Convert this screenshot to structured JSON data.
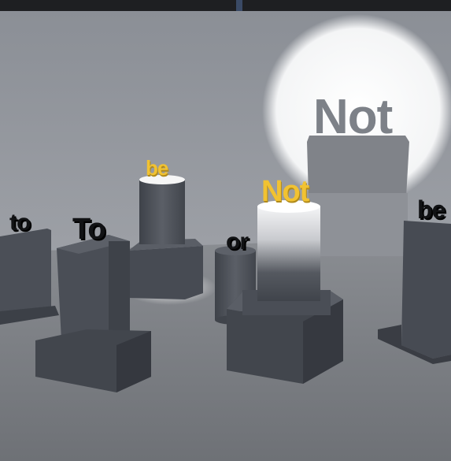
{
  "scene": {
    "words": {
      "to_left": "to",
      "to_front": "To",
      "be_back": "be",
      "or_mid": "or",
      "not_center": "Not",
      "be_right": "be",
      "not_wall_shadow": "Not"
    },
    "colors": {
      "wall": "#8d9097",
      "floor": "#7a7d82",
      "pedestal": "#4b4f57",
      "pedestal_dark": "#3b3e45",
      "gold_text": "#f1c232",
      "black_text": "#111214",
      "spotlight": "#ffffff"
    }
  }
}
